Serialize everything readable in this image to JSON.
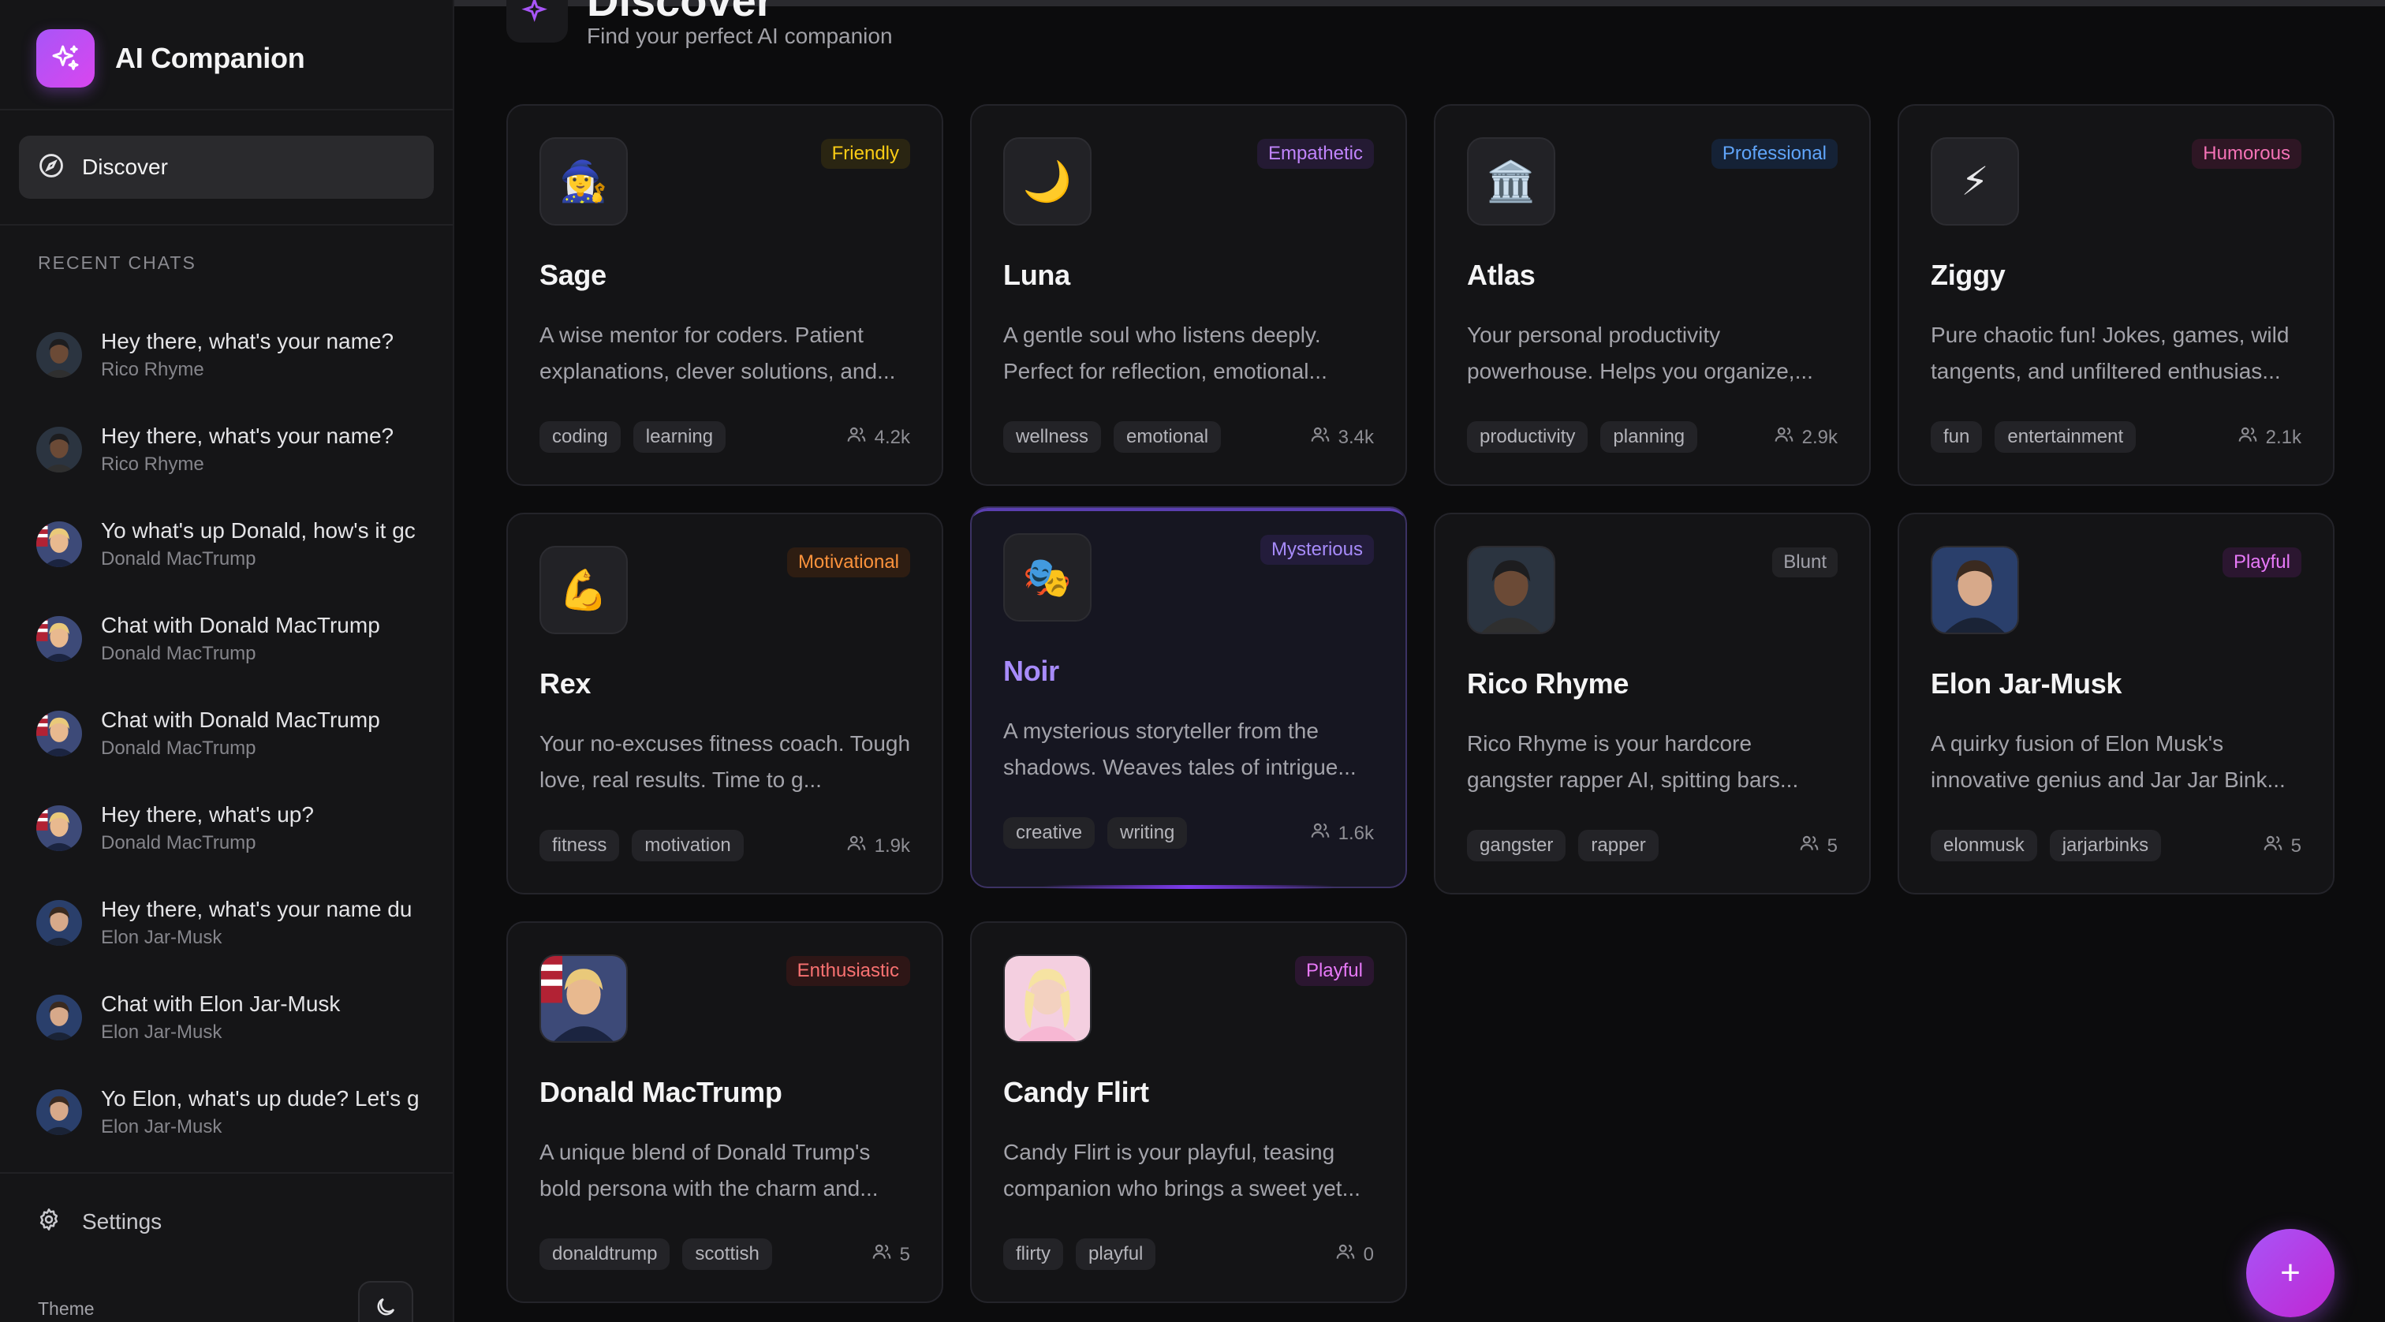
{
  "app": {
    "name": "AI Companion"
  },
  "nav": {
    "discover": "Discover"
  },
  "sidebar": {
    "recent_title": "RECENT CHATS",
    "chats": [
      {
        "title": "Hey there, what's your name?",
        "sub": "Rico Rhyme",
        "avatar": "rico"
      },
      {
        "title": "Hey there, what's your name?",
        "sub": "Rico Rhyme",
        "avatar": "rico"
      },
      {
        "title": "Yo what's up Donald, how's it gc",
        "sub": "Donald MacTrump",
        "avatar": "donald"
      },
      {
        "title": "Chat with Donald MacTrump",
        "sub": "Donald MacTrump",
        "avatar": "donald"
      },
      {
        "title": "Chat with Donald MacTrump",
        "sub": "Donald MacTrump",
        "avatar": "donald"
      },
      {
        "title": "Hey there, what's up?",
        "sub": "Donald MacTrump",
        "avatar": "donald"
      },
      {
        "title": "Hey there, what's your name du",
        "sub": "Elon Jar-Musk",
        "avatar": "elon"
      },
      {
        "title": "Chat with Elon Jar-Musk",
        "sub": "Elon Jar-Musk",
        "avatar": "elon"
      },
      {
        "title": "Yo Elon, what's up dude? Let's g",
        "sub": "Elon Jar-Musk",
        "avatar": "elon"
      }
    ],
    "settings": "Settings",
    "theme": "Theme"
  },
  "header": {
    "title": "Discover",
    "subtitle": "Find your perfect AI companion"
  },
  "companions": [
    {
      "name": "Sage",
      "badge": "Friendly",
      "badge_color": "#facc15",
      "badge_bg": "#2a2512",
      "emoji": "🧙‍♀️",
      "desc": "A wise mentor for coders. Patient explanations, clever solutions, and...",
      "tags": [
        "coding",
        "learning"
      ],
      "count": "4.2k"
    },
    {
      "name": "Luna",
      "badge": "Empathetic",
      "badge_color": "#c084fc",
      "badge_bg": "#241a33",
      "emoji": "🌙",
      "desc": "A gentle soul who listens deeply. Perfect for reflection, emotional...",
      "tags": [
        "wellness",
        "emotional"
      ],
      "count": "3.4k"
    },
    {
      "name": "Atlas",
      "badge": "Professional",
      "badge_color": "#60a5fa",
      "badge_bg": "#152236",
      "emoji": "🏛️",
      "desc": "Your personal productivity powerhouse. Helps you organize,...",
      "tags": [
        "productivity",
        "planning"
      ],
      "count": "2.9k"
    },
    {
      "name": "Ziggy",
      "badge": "Humorous",
      "badge_color": "#f472b6",
      "badge_bg": "#2e1624",
      "emoji": "⚡",
      "desc": "Pure chaotic fun! Jokes, games, wild tangents, and unfiltered enthusias...",
      "tags": [
        "fun",
        "entertainment"
      ],
      "count": "2.1k"
    },
    {
      "name": "Rex",
      "badge": "Motivational",
      "badge_color": "#fb923c",
      "badge_bg": "#2e1d12",
      "emoji": "💪",
      "desc": "Your no-excuses fitness coach. Tough love, real results. Time to g...",
      "tags": [
        "fitness",
        "motivation"
      ],
      "count": "1.9k"
    },
    {
      "name": "Noir",
      "badge": "Mysterious",
      "badge_color": "#a78bfa",
      "badge_bg": "#231c3b",
      "emoji": "🎭",
      "desc": "A mysterious storyteller from the shadows. Weaves tales of intrigue...",
      "tags": [
        "creative",
        "writing"
      ],
      "count": "1.6k"
    },
    {
      "name": "Rico Rhyme",
      "badge": "Blunt",
      "badge_color": "#a1a1aa",
      "badge_bg": "#222225",
      "emoji": "",
      "desc": "Rico Rhyme is your hardcore gangster rapper AI, spitting bars...",
      "tags": [
        "gangster",
        "rapper"
      ],
      "count": "5"
    },
    {
      "name": "Elon Jar-Musk",
      "badge": "Playful",
      "badge_color": "#e879f9",
      "badge_bg": "#2b1630",
      "emoji": "",
      "desc": "A quirky fusion of Elon Musk's innovative genius and Jar Jar Bink...",
      "tags": [
        "elonmusk",
        "jarjarbinks"
      ],
      "count": "5"
    },
    {
      "name": "Donald MacTrump",
      "badge": "Enthusiastic",
      "badge_color": "#f87171",
      "badge_bg": "#2e1616",
      "emoji": "",
      "desc": "A unique blend of Donald Trump's bold persona with the charm and...",
      "tags": [
        "donaldtrump",
        "scottish"
      ],
      "count": "5"
    },
    {
      "name": "Candy Flirt",
      "badge": "Playful",
      "badge_color": "#e879f9",
      "badge_bg": "#2b1630",
      "emoji": "",
      "desc": "Candy Flirt is your playful, teasing companion who brings a sweet yet...",
      "tags": [
        "flirty",
        "playful"
      ],
      "count": "0"
    }
  ],
  "fab": {
    "label": "+"
  }
}
